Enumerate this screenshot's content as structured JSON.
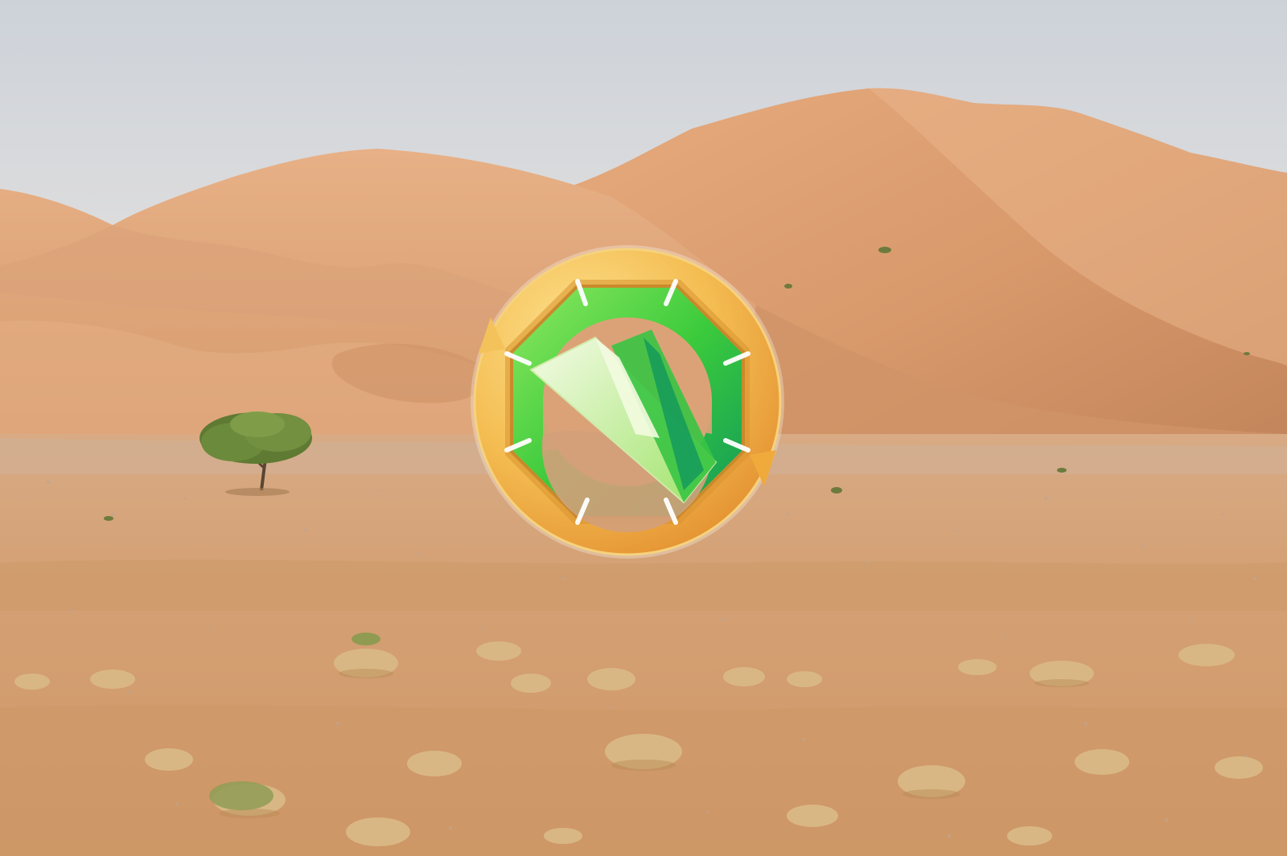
{
  "scene": {
    "description_free": true,
    "colors": {
      "sky_top": "#cfd3da",
      "sky_bottom": "#e8e4df",
      "dune_light": "#e3a679",
      "dune_mid": "#d19264",
      "dune_shadow": "#b87a52",
      "plain": "#d9a67a",
      "plain_dark": "#c48d61",
      "shrub": "#6f8a3c",
      "shrub_dark": "#4f6a2a",
      "grass": "#d8b27a",
      "badge_gold": "#f2b84a",
      "badge_gold_light": "#fcd77a",
      "badge_gold_dark": "#e08e2c",
      "badge_green": "#3bc93a",
      "badge_green_dark": "#129a56",
      "badge_lime": "#7ee34a",
      "badge_pale": "#e9f8cf"
    },
    "icons": [
      "badge-icon"
    ]
  }
}
